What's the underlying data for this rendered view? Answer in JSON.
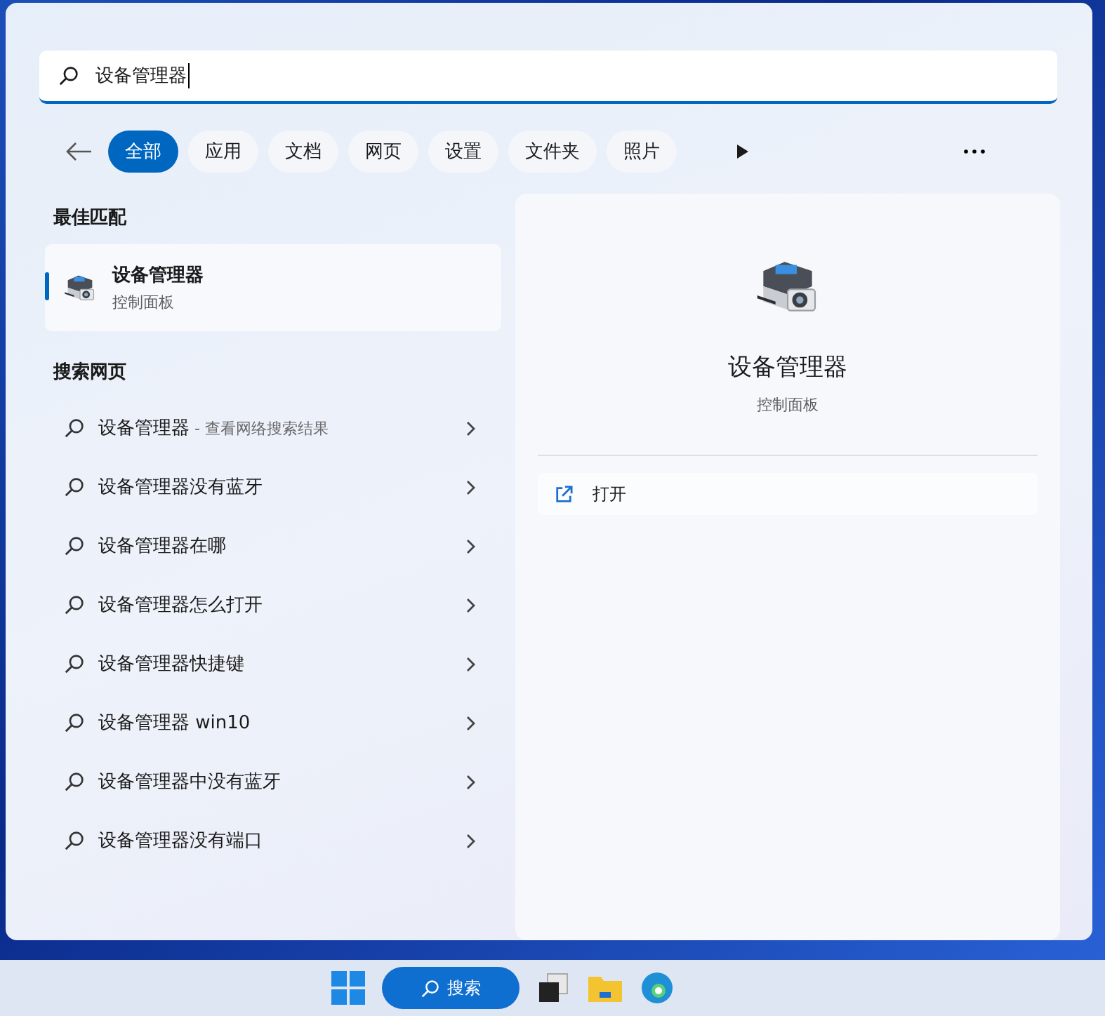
{
  "search": {
    "value": "设备管理器"
  },
  "filters": [
    {
      "label": "全部",
      "selected": true
    },
    {
      "label": "应用",
      "selected": false
    },
    {
      "label": "文档",
      "selected": false
    },
    {
      "label": "网页",
      "selected": false
    },
    {
      "label": "设置",
      "selected": false
    },
    {
      "label": "文件夹",
      "selected": false
    },
    {
      "label": "照片",
      "selected": false
    }
  ],
  "best_match": {
    "heading": "最佳匹配",
    "title": "设备管理器",
    "subtitle": "控制面板",
    "selected": true
  },
  "web": {
    "heading": "搜索网页",
    "items": [
      {
        "text": "设备管理器",
        "hint": "- 查看网络搜索结果"
      },
      {
        "text": "设备管理器没有蓝牙"
      },
      {
        "text": "设备管理器在哪"
      },
      {
        "text": "设备管理器怎么打开"
      },
      {
        "text": "设备管理器快捷键"
      },
      {
        "text": "设备管理器 win10"
      },
      {
        "text": "设备管理器中没有蓝牙"
      },
      {
        "text": "设备管理器没有端口"
      }
    ]
  },
  "detail": {
    "title": "设备管理器",
    "subtitle": "控制面板",
    "actions": [
      {
        "label": "打开"
      }
    ]
  },
  "taskbar": {
    "search_label": "搜索"
  }
}
